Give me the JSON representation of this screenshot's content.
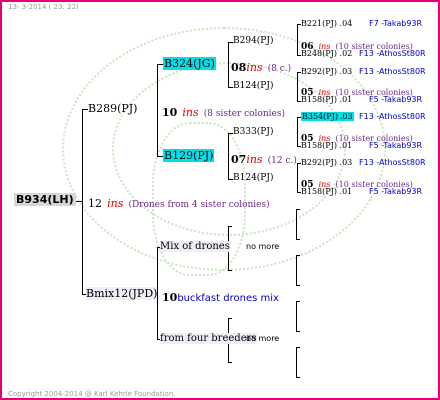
{
  "header": {
    "date": "13- 3-2014 ( 23: 22)"
  },
  "footer": {
    "copyright": "Copyright 2004-2014 @ Karl Kehrle Foundation."
  },
  "root": {
    "id": "B934(LH)",
    "ins_count": "12",
    "ins_label": "ins",
    "drones_note": "(Drones from 4 sister colonies)"
  },
  "gen1": {
    "queen": {
      "id": "B289(PJ)",
      "ins_count": "10",
      "ins_label": "ins",
      "sisters_note": "(8 sister colonies)"
    },
    "drone": {
      "id": "Bmix12(JPD)",
      "count": "10",
      "label": "buckfast drones mix"
    }
  },
  "gen2": {
    "b324": {
      "id": "B324(JG)",
      "ins_count": "08",
      "ins_label": "ins",
      "note": "(8 c.)"
    },
    "b129": {
      "id": "B129(PJ)",
      "ins_count": "07",
      "ins_label": "ins",
      "note": "(12 c.)"
    },
    "mix": {
      "label": "Mix of drones",
      "more": "no more"
    },
    "four": {
      "label": "from four breeders",
      "more": "no more"
    }
  },
  "gen3": {
    "b294": {
      "id": "B294(PJ)",
      "ins_count": "06",
      "ins_label": "ins",
      "note": "(10 sister colonies)"
    },
    "b124a": {
      "id": "B124(PJ)",
      "ins_count": "05",
      "ins_label": "ins",
      "note": "(10 sister colonies)"
    },
    "b333": {
      "id": "B333(PJ)",
      "ins_count": "05",
      "ins_label": "ins",
      "note": "(10 sister colonies)"
    },
    "b124b": {
      "id": "B124(PJ)",
      "ins_count": "05",
      "ins_label": "ins",
      "note": "(10 sister colonies)"
    }
  },
  "gen4": [
    {
      "id": "B221(PJ)",
      "val": ".04",
      "code": "F7 -Takab93R"
    },
    {
      "id": "B248(PJ)",
      "val": ".02",
      "code": "F13 -AthosSt80R"
    },
    {
      "id": "B292(PJ)",
      "val": ".03",
      "code": "F13 -AthosSt80R"
    },
    {
      "id": "B158(PJ)",
      "val": ".01",
      "code": "F5 -Takab93R"
    },
    {
      "id": "B354(PJ)",
      "val": ".03",
      "code": "F13 -AthosSt80R"
    },
    {
      "id": "B158(PJ)",
      "val": ".01",
      "code": "F5 -Takab93R"
    },
    {
      "id": "B292(PJ)",
      "val": ".03",
      "code": "F13 -AthosSt80R"
    },
    {
      "id": "B158(PJ)",
      "val": ".01",
      "code": "F5 -Takab93R"
    }
  ]
}
